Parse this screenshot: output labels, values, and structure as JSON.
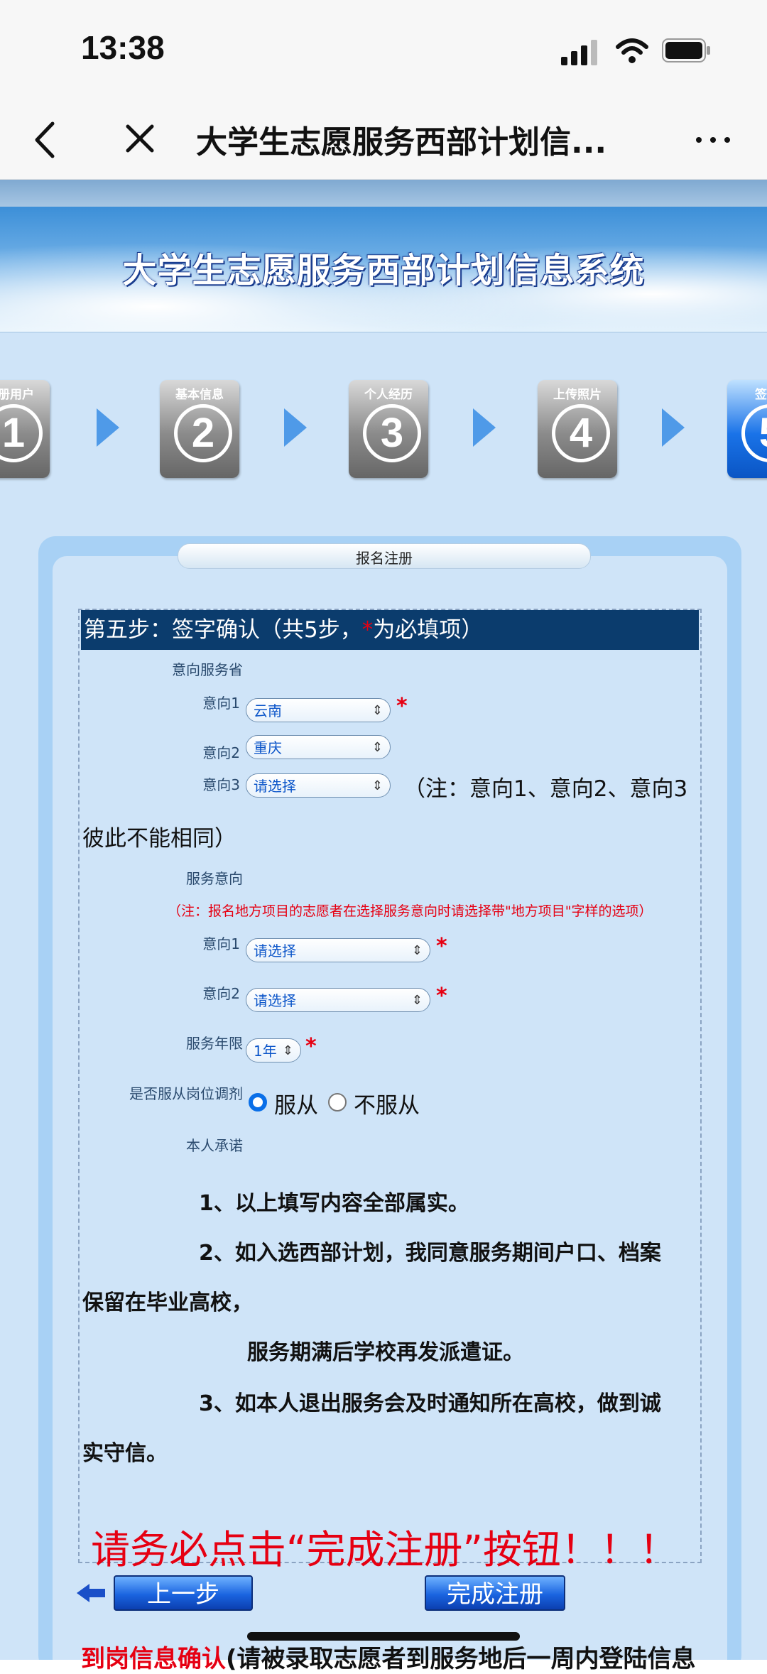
{
  "status": {
    "time": "13:38"
  },
  "nav": {
    "title": "大学生志愿服务西部计划信..."
  },
  "banner": {
    "title": "大学生志愿服务西部计划信息系统"
  },
  "steps": [
    {
      "label": "注册用户",
      "num": "1"
    },
    {
      "label": "基本信息",
      "num": "2"
    },
    {
      "label": "个人经历",
      "num": "3"
    },
    {
      "label": "上传照片",
      "num": "4"
    },
    {
      "label": "签字",
      "num": "5"
    }
  ],
  "panel": {
    "tab_title": "报名注册"
  },
  "form": {
    "header_prefix": "第五步：签字确认（共5步，",
    "header_star": "*",
    "header_suffix": "为必填项）",
    "province_label": "意向服务省",
    "intent1_label": "意向1",
    "intent1_value": "云南",
    "intent2_label": "意向2",
    "intent2_value": "重庆",
    "intent3_label": "意向3",
    "intent3_value": "请选择",
    "intent_note_line1": "（注：意向1、意向2、意向3",
    "intent_note_line2": "彼此不能相同）",
    "service_label": "服务意向",
    "service_note": "（注：报名地方项目的志愿者在选择服务意向时请选择带\"地方项目\"字样的选项）",
    "service1_label": "意向1",
    "service1_value": "请选择",
    "service2_label": "意向2",
    "service2_value": "请选择",
    "years_label": "服务年限",
    "years_value": "1年",
    "adjust_label": "是否服从岗位调剂",
    "adjust_yes": "服从",
    "adjust_no": "不服从",
    "adjust_selected": "服从",
    "pledge_label": "本人承诺",
    "pledge1": "1、以上填写内容全部属实。",
    "pledge2a": "2、如入选西部计划，我同意服务期间户口、档案",
    "pledge2b": "保留在毕业高校，",
    "pledge2c": "服务期满后学校再发派遣证。",
    "pledge3a": "3、如本人退出服务会及时通知所在高校，做到诚",
    "pledge3b": "实守信。",
    "warning": "请务必点击“完成注册”按钮！！！",
    "required_mark": "*"
  },
  "buttons": {
    "prev": "上一步",
    "finish": "完成注册"
  },
  "footer": {
    "red": "到岗信息确认",
    "black": "(请被录取志愿者到服务地后一周内登陆信息"
  }
}
